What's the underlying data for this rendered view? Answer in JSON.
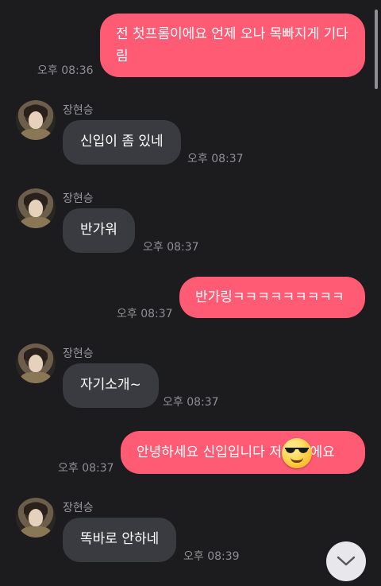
{
  "messages": [
    {
      "type": "out",
      "lines": [
        "전 첫프롬이에요 언제 오나 목빠지게 기다",
        "림"
      ],
      "time": "오후 08:36"
    },
    {
      "type": "in",
      "sender": "장현승",
      "text": "신입이 좀 있네",
      "time": "오후 08:37"
    },
    {
      "type": "in",
      "sender": "장현승",
      "text": "반가워",
      "time": "오후 08:37"
    },
    {
      "type": "out",
      "lines": [
        "반가링ㅋㅋㅋㅋㅋㅋㅋㅋㅋ"
      ],
      "time": "오후 08:37"
    },
    {
      "type": "in",
      "sender": "장현승",
      "text": "자기소개~",
      "time": "오후 08:37"
    },
    {
      "type": "out",
      "lines": [
        "안녕하세요 신입입니다 저",
        "이에요"
      ],
      "time": "오후 08:37",
      "sticker": "sunglasses-emoji"
    },
    {
      "type": "in",
      "sender": "장현승",
      "text": "똑바로 안하네",
      "time": "오후 08:39"
    }
  ],
  "colors": {
    "background": "#1c1c1e",
    "outgoing_bubble": "#ff5b74",
    "incoming_bubble": "#3a3b40",
    "timestamp": "#8e8e93"
  },
  "icons": {
    "scroll_down": "chevron-down-icon",
    "avatar": "profile-photo"
  }
}
